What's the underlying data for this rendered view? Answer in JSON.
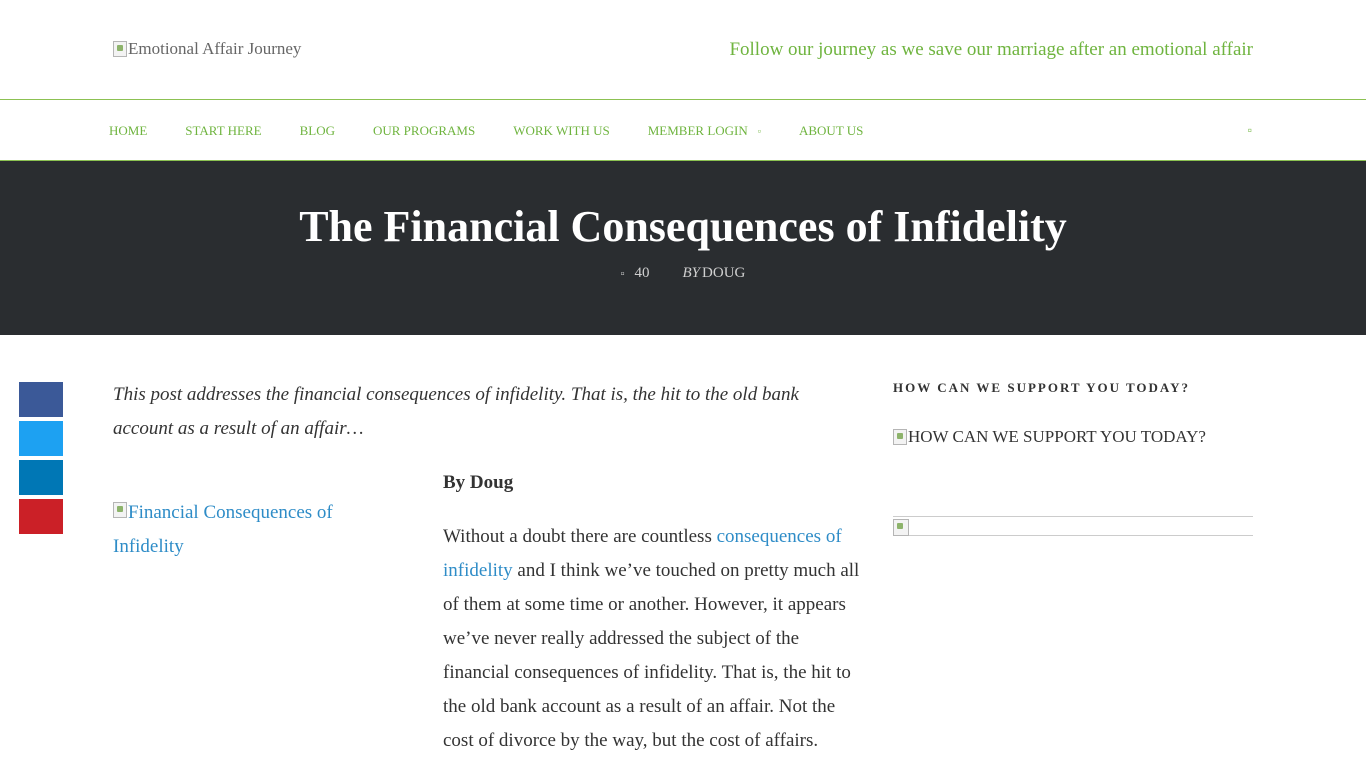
{
  "header": {
    "logo_alt": "Emotional Affair Journey",
    "tagline": "Follow our journey as we save our marriage after an emotional affair"
  },
  "nav": {
    "items": [
      {
        "label": "HOME"
      },
      {
        "label": "START HERE"
      },
      {
        "label": "BLOG"
      },
      {
        "label": "OUR PROGRAMS"
      },
      {
        "label": "WORK WITH US"
      },
      {
        "label": "MEMBER LOGIN"
      },
      {
        "label": "ABOUT US"
      }
    ],
    "member_caret": "▫",
    "search_icon": "▫"
  },
  "hero": {
    "title": "The Financial Consequences of Infidelity",
    "comment_icon": "▫",
    "comment_count": "40",
    "by_label": "BY",
    "author": "DOUG"
  },
  "share": {
    "buttons": [
      "facebook",
      "twitter",
      "linkedin",
      "pinterest"
    ],
    "colors": {
      "facebook": "#3b5998",
      "twitter": "#1da1f2",
      "linkedin": "#0077b5",
      "pinterest": "#cb2027"
    }
  },
  "article": {
    "intro": "This post addresses the financial consequences of infidelity. That is, the hit to the old bank account as a result of an affair…",
    "featured_image_alt": "Financial Consequences of Infidelity",
    "byline": "By Doug",
    "body_before_link": "Without a doubt there are countless ",
    "body_link": "consequences of infidelity",
    "body_after_link": " and I think we’ve touched on pretty much all of them at some time or another.  However, it appears we’ve never really addressed the subject of the financial consequences of infidelity.  That is, the hit to the old bank account as a result of an affair.  Not the cost of divorce by the way, but the cost of affairs."
  },
  "sidebar": {
    "heading": "HOW CAN WE SUPPORT YOU TODAY?",
    "image_alt": "HOW CAN WE SUPPORT YOU TODAY?"
  },
  "colors": {
    "accent_green": "#6fb43f",
    "hero_bg": "#2a2d30",
    "link_blue": "#2e8cc7"
  }
}
